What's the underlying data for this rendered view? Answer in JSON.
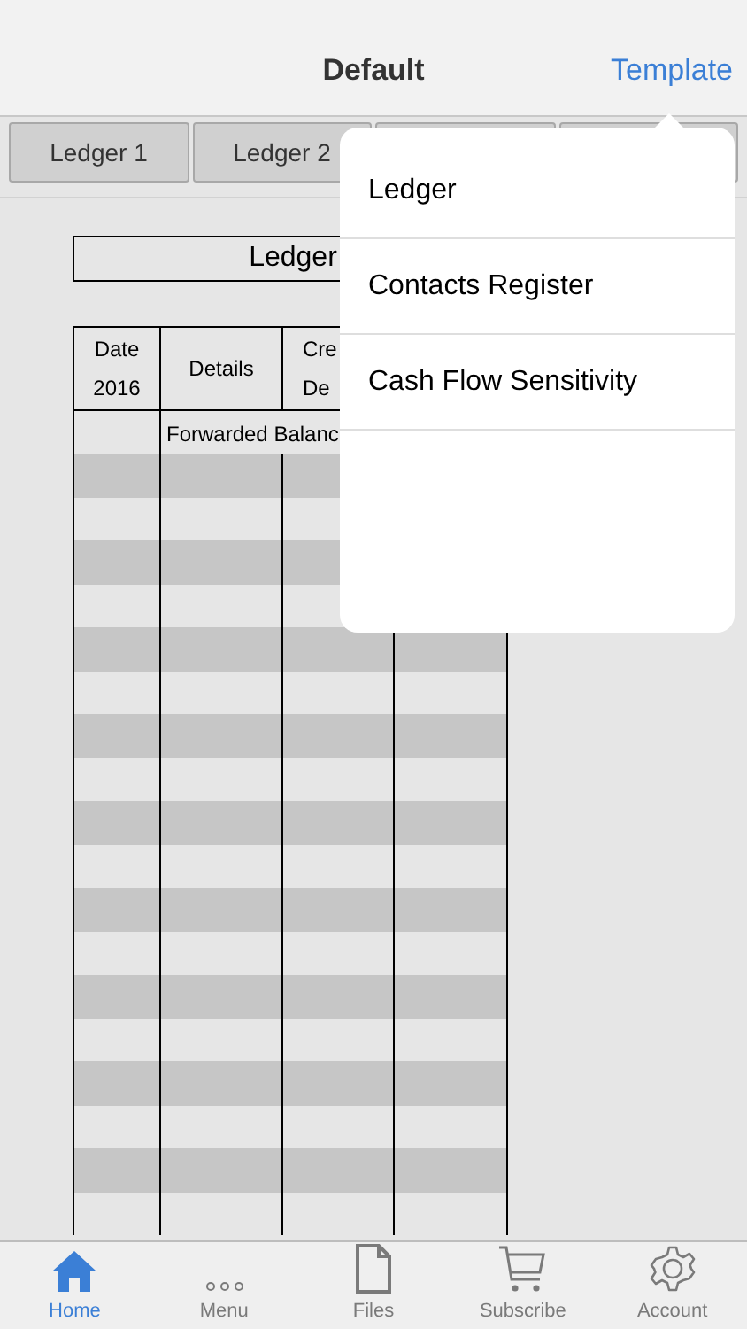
{
  "nav_bar": {
    "title": "Default",
    "action": "Template"
  },
  "sheet_tabs": [
    {
      "label": "Ledger 1"
    },
    {
      "label": "Ledger 2"
    }
  ],
  "sheet": {
    "title": "Ledger",
    "header": [
      "Date\n2016",
      "Details",
      "Cre\nDe"
    ],
    "first_row": "Forwarded Balanc"
  },
  "template_menu": [
    "Ledger",
    "Contacts Register",
    "Cash Flow Sensitivity"
  ],
  "tab_bar": [
    {
      "label": "Home",
      "selected": true
    },
    {
      "label": "Menu",
      "selected": false
    },
    {
      "label": "Files",
      "selected": false
    },
    {
      "label": "Subscribe",
      "selected": false
    },
    {
      "label": "Account",
      "selected": false
    }
  ]
}
